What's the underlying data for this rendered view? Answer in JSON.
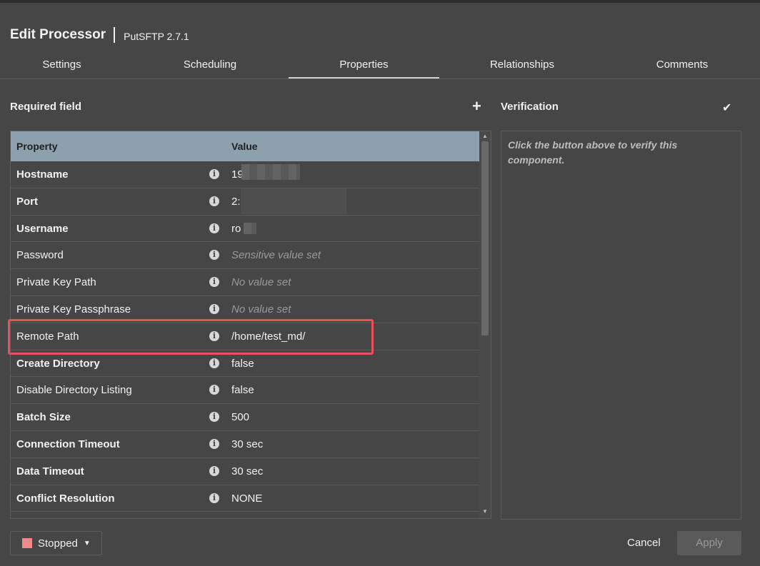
{
  "header": {
    "title": "Edit Processor",
    "subtitle": "PutSFTP 2.7.1"
  },
  "tabs": [
    {
      "label": "Settings",
      "active": false
    },
    {
      "label": "Scheduling",
      "active": false
    },
    {
      "label": "Properties",
      "active": true
    },
    {
      "label": "Relationships",
      "active": false
    },
    {
      "label": "Comments",
      "active": false
    }
  ],
  "properties_panel": {
    "required_label": "Required field",
    "add_icon": "plus-icon",
    "columns": {
      "property": "Property",
      "value": "Value"
    },
    "rows": [
      {
        "name": "Hostname",
        "required": true,
        "value": "19",
        "empty": false
      },
      {
        "name": "Port",
        "required": true,
        "value": "2:",
        "empty": false
      },
      {
        "name": "Username",
        "required": true,
        "value": "ro",
        "empty": false
      },
      {
        "name": "Password",
        "required": false,
        "value": "Sensitive value set",
        "empty": true
      },
      {
        "name": "Private Key Path",
        "required": false,
        "value": "No value set",
        "empty": true
      },
      {
        "name": "Private Key Passphrase",
        "required": false,
        "value": "No value set",
        "empty": true
      },
      {
        "name": "Remote Path",
        "required": false,
        "value": "/home/test_md/",
        "empty": false
      },
      {
        "name": "Create Directory",
        "required": true,
        "value": "false",
        "empty": false
      },
      {
        "name": "Disable Directory Listing",
        "required": false,
        "value": "false",
        "empty": false
      },
      {
        "name": "Batch Size",
        "required": true,
        "value": "500",
        "empty": false
      },
      {
        "name": "Connection Timeout",
        "required": true,
        "value": "30 sec",
        "empty": false
      },
      {
        "name": "Data Timeout",
        "required": true,
        "value": "30 sec",
        "empty": false
      },
      {
        "name": "Conflict Resolution",
        "required": true,
        "value": "NONE",
        "empty": false
      }
    ]
  },
  "verification": {
    "label": "Verification",
    "icon": "checkmark-icon",
    "hint": "Click the button above to verify this component."
  },
  "footer": {
    "status_label": "Stopped",
    "status_color": "#f08a8a",
    "cancel_label": "Cancel",
    "apply_label": "Apply"
  },
  "colors": {
    "background": "#464646",
    "table_header": "#8ca1ad",
    "highlight": "#e8505b"
  }
}
